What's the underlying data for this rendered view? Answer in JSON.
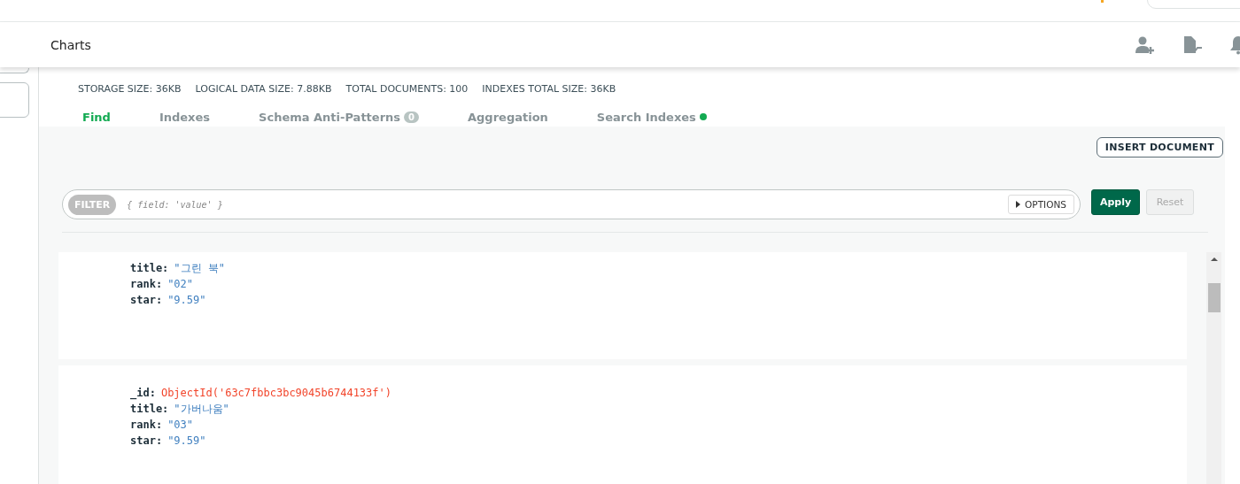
{
  "nav": {
    "tabs": [
      {
        "label": "Charts",
        "selected": false
      }
    ]
  },
  "collection": {
    "stats": [
      {
        "label": "STORAGE SIZE:",
        "value": "36KB"
      },
      {
        "label": "LOGICAL DATA SIZE:",
        "value": "7.88KB"
      },
      {
        "label": "TOTAL DOCUMENTS:",
        "value": "100"
      },
      {
        "label": "INDEXES TOTAL SIZE:",
        "value": "36KB"
      }
    ]
  },
  "tabs": [
    {
      "label": "Find",
      "selected": true
    },
    {
      "label": "Indexes",
      "selected": false
    },
    {
      "label": "Schema Anti-Patterns",
      "selected": false,
      "badge": "0"
    },
    {
      "label": "Aggregation",
      "selected": false
    },
    {
      "label": "Search Indexes",
      "selected": false,
      "dot": true
    }
  ],
  "insert_button": "INSERT DOCUMENT",
  "filter": {
    "label": "FILTER",
    "placeholder": "{ field: 'value' }",
    "options": "OPTIONS",
    "apply": "Apply",
    "reset": "Reset",
    "reset_disabled": true
  },
  "documents": [
    {
      "fields": [
        {
          "key": "title:",
          "value": "\"그린 북\"",
          "kind": "string"
        },
        {
          "key": "rank:",
          "value": "\"02\"",
          "kind": "string"
        },
        {
          "key": "star:",
          "value": "\"9.59\"",
          "kind": "string"
        }
      ]
    },
    {
      "fields": [
        {
          "key": "_id:",
          "value": "ObjectId('63c7fbbc3bc9045b6744133f')",
          "kind": "oid"
        },
        {
          "key": "title:",
          "value": "\"가버나움\"",
          "kind": "string"
        },
        {
          "key": "rank:",
          "value": "\"03\"",
          "kind": "string"
        },
        {
          "key": "star:",
          "value": "\"9.59\"",
          "kind": "string"
        }
      ]
    }
  ]
}
